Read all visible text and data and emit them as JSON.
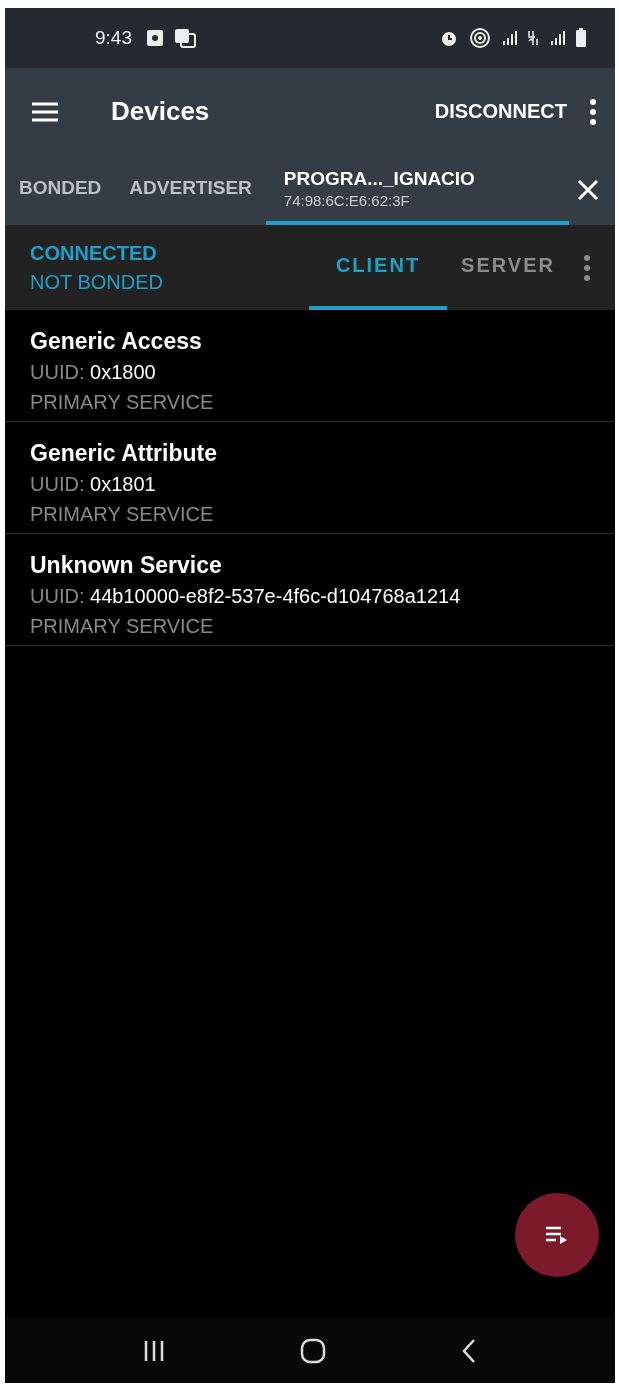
{
  "status_bar": {
    "time": "9:43"
  },
  "toolbar": {
    "title": "Devices",
    "action": "DISCONNECT"
  },
  "tabs": [
    {
      "label": "BONDED",
      "selected": false
    },
    {
      "label": "ADVERTISER",
      "selected": false
    },
    {
      "label": "PROGRA..._IGNACIO",
      "subtitle": "74:98:6C:E6:62:3F",
      "selected": true
    }
  ],
  "connection": {
    "state": "CONNECTED",
    "bond": "NOT BONDED"
  },
  "sub_tabs": [
    {
      "label": "CLIENT",
      "selected": true
    },
    {
      "label": "SERVER",
      "selected": false
    }
  ],
  "services": [
    {
      "name": "Generic Access",
      "uuid_label": "UUID:",
      "uuid": "0x1800",
      "type": "PRIMARY SERVICE"
    },
    {
      "name": "Generic Attribute",
      "uuid_label": "UUID:",
      "uuid": "0x1801",
      "type": "PRIMARY SERVICE"
    },
    {
      "name": "Unknown Service",
      "uuid_label": "UUID:",
      "uuid": "44b10000-e8f2-537e-4f6c-d104768a1214",
      "type": "PRIMARY SERVICE"
    }
  ]
}
